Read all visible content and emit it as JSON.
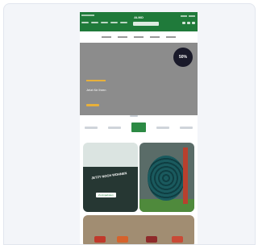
{
  "header": {
    "logo": "ALMO"
  },
  "hero": {
    "title": "Jetzt für Ihren",
    "badge": "50%"
  },
  "promo": {
    "left_text": "Jetzt Noch Wohnen",
    "left_cta": "Zu Angeboten"
  },
  "colors": {
    "brand_green": "#1f7a3a",
    "accent_orange": "#e8b03a"
  }
}
